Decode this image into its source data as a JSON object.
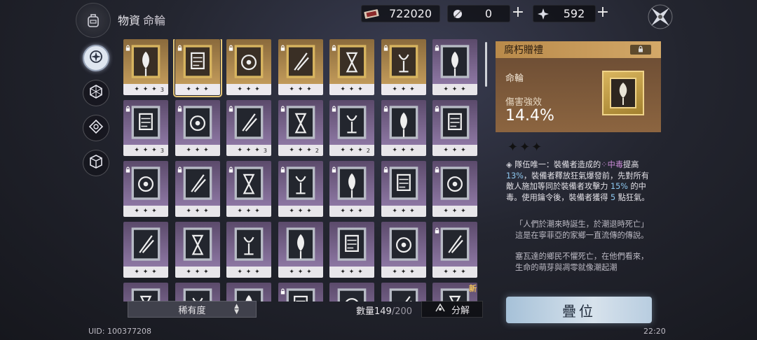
{
  "header": {
    "title": "物資",
    "subtitle": "命輪"
  },
  "currencies": [
    {
      "icon": "ticket-icon",
      "value": "722020"
    },
    {
      "icon": "feather-orb-icon",
      "value": "0"
    },
    {
      "icon": "star-crystal-icon",
      "value": "592"
    }
  ],
  "side_nav": [
    {
      "icon": "wheel-icon",
      "active": true
    },
    {
      "icon": "hexagon-icon",
      "active": false
    },
    {
      "icon": "diamond-target-icon",
      "active": false
    },
    {
      "icon": "cube-icon",
      "active": false
    }
  ],
  "grid": {
    "rows": [
      [
        {
          "tier": "gold",
          "stars": "✦ ✦ ✦",
          "count": "3",
          "locked": true,
          "selected": false
        },
        {
          "tier": "gold",
          "stars": "✦ ✦ ✦",
          "count": "",
          "locked": true,
          "selected": true
        },
        {
          "tier": "gold",
          "stars": "✦ ✦ ✦",
          "count": "",
          "locked": true,
          "selected": false
        },
        {
          "tier": "gold",
          "stars": "✦ ✦ ✦",
          "count": "",
          "locked": true,
          "selected": false
        },
        {
          "tier": "gold",
          "stars": "✦ ✦ ✦",
          "count": "",
          "locked": true,
          "selected": false
        },
        {
          "tier": "gold",
          "stars": "✦ ✦ ✦",
          "count": "",
          "locked": true,
          "selected": false
        },
        {
          "tier": "purple",
          "stars": "✦ ✦ ✦",
          "count": "",
          "locked": true,
          "selected": false
        }
      ],
      [
        {
          "tier": "purple",
          "stars": "✦ ✦ ✦",
          "count": "3",
          "locked": true,
          "selected": false
        },
        {
          "tier": "purple",
          "stars": "✦ ✦ ✦",
          "count": "",
          "locked": true,
          "selected": false
        },
        {
          "tier": "purple",
          "stars": "✦ ✦ ✦",
          "count": "3",
          "locked": true,
          "selected": false
        },
        {
          "tier": "purple",
          "stars": "✦ ✦ ✦",
          "count": "2",
          "locked": true,
          "selected": false
        },
        {
          "tier": "purple",
          "stars": "✦ ✦ ✦",
          "count": "2",
          "locked": true,
          "selected": false
        },
        {
          "tier": "purple",
          "stars": "✦ ✦ ✦",
          "count": "",
          "locked": true,
          "selected": false
        },
        {
          "tier": "purple",
          "stars": "✦ ✦ ✦",
          "count": "",
          "locked": true,
          "selected": false
        }
      ],
      [
        {
          "tier": "purple",
          "stars": "✦ ✦ ✦",
          "count": "",
          "locked": true,
          "selected": false
        },
        {
          "tier": "purple",
          "stars": "✦ ✦ ✦",
          "count": "",
          "locked": true,
          "selected": false
        },
        {
          "tier": "purple",
          "stars": "✦ ✦ ✦",
          "count": "",
          "locked": true,
          "selected": false
        },
        {
          "tier": "purple",
          "stars": "✦ ✦ ✦",
          "count": "",
          "locked": true,
          "selected": false
        },
        {
          "tier": "purple",
          "stars": "✦ ✦ ✦",
          "count": "",
          "locked": true,
          "selected": false
        },
        {
          "tier": "purple",
          "stars": "✦ ✦ ✦",
          "count": "",
          "locked": true,
          "selected": false
        },
        {
          "tier": "purple",
          "stars": "✦ ✦ ✦",
          "count": "",
          "locked": true,
          "selected": false
        }
      ],
      [
        {
          "tier": "purple",
          "stars": "✦ ✦ ✦",
          "count": "",
          "locked": false,
          "selected": false
        },
        {
          "tier": "purple",
          "stars": "✦ ✦ ✦",
          "count": "",
          "locked": false,
          "selected": false
        },
        {
          "tier": "purple",
          "stars": "✦ ✦ ✦",
          "count": "",
          "locked": false,
          "selected": false
        },
        {
          "tier": "purple",
          "stars": "✦ ✦ ✦",
          "count": "",
          "locked": false,
          "selected": false
        },
        {
          "tier": "purple",
          "stars": "✦ ✦ ✦",
          "count": "",
          "locked": false,
          "selected": false
        },
        {
          "tier": "purple",
          "stars": "✦ ✦ ✦",
          "count": "",
          "locked": false,
          "selected": false
        },
        {
          "tier": "purple",
          "stars": "✦ ✦ ✦",
          "count": "",
          "locked": true,
          "selected": false
        }
      ],
      [
        {
          "tier": "purple",
          "stars": "",
          "count": "",
          "locked": false,
          "selected": false
        },
        {
          "tier": "purple",
          "stars": "",
          "count": "",
          "locked": false,
          "selected": false
        },
        {
          "tier": "purple",
          "stars": "",
          "count": "",
          "locked": false,
          "selected": false
        },
        {
          "tier": "purple",
          "stars": "",
          "count": "",
          "locked": true,
          "selected": false
        },
        {
          "tier": "purple",
          "stars": "",
          "count": "",
          "locked": false,
          "selected": false
        },
        {
          "tier": "purple",
          "stars": "",
          "count": "",
          "locked": false,
          "selected": false
        },
        {
          "tier": "purple",
          "stars": "",
          "count": "",
          "locked": false,
          "selected": false
        }
      ]
    ],
    "new_label": "新"
  },
  "bottom": {
    "sort_label": "稀有度",
    "count_label": "數量149",
    "count_max": "/200",
    "decompose_label": "分解",
    "uid": "UID: 100377208",
    "clock": "22:20"
  },
  "detail": {
    "name": "腐朽贈禮",
    "category": "命輪",
    "stat_name": "傷害強效",
    "stat_value": "14.4%",
    "rarity": "✦✦✦",
    "effect": {
      "prefix": "隊伍唯一：裝備者造成的",
      "keyword": "中毒",
      "part1": "提高",
      "num1": "13%",
      "part2": "，裝備者釋放狂氣爆發前，先對所有敵人施加等同於裝備者攻擊力",
      "num2": "15%",
      "part3": "的中毒。使用鑰令後，裝備者獲得",
      "num3": "5",
      "part4": "點狂氣。"
    },
    "lore_quote": "「人們於潮來時誕生，於潮退時死亡」",
    "lore_line": "這是在寧菲亞的家鄉一直流傳的傳說。",
    "lore_more": "塞瓦達的鄉民不懼死亡，在他們看來，生命的萌芽與凋零就像潮起潮",
    "stack_button": "疊位"
  }
}
